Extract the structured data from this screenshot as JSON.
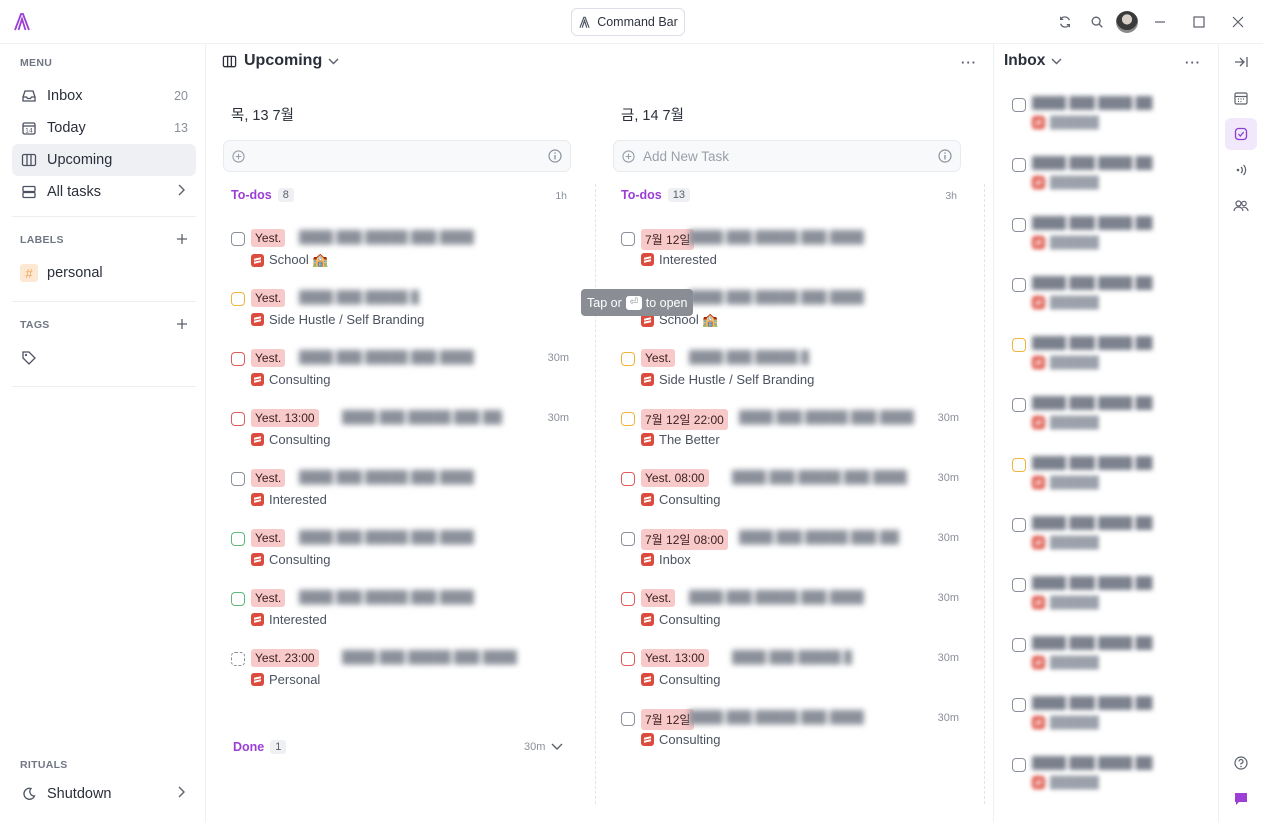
{
  "titlebar": {
    "command_bar_label": "Command Bar"
  },
  "sidebar": {
    "menu_title": "MENU",
    "items": [
      {
        "label": "Inbox",
        "count": "20",
        "icon": "inbox-icon"
      },
      {
        "label": "Today",
        "count": "13",
        "icon": "calendar-day-icon"
      },
      {
        "label": "Upcoming",
        "count": "",
        "icon": "columns-icon"
      },
      {
        "label": "All tasks",
        "count": "",
        "icon": "stack-icon"
      }
    ],
    "labels_title": "LABELS",
    "labels": [
      {
        "name": "personal",
        "color": "#f0a35a"
      }
    ],
    "tags_title": "TAGS",
    "rituals_title": "RITUALS",
    "rituals": [
      {
        "label": "Shutdown"
      }
    ]
  },
  "main": {
    "view_title": "Upcoming",
    "columns": [
      {
        "date": "목, 13 7월",
        "add_placeholder": "",
        "section_label": "To-dos",
        "section_count": "8",
        "section_time": "1h",
        "tasks": [
          {
            "badge": "Yest.",
            "project": "School 🏫",
            "duration": "",
            "check": "gray"
          },
          {
            "badge": "Yest.",
            "project": "Side Hustle / Self Branding",
            "duration": "",
            "check": "orange"
          },
          {
            "badge": "Yest.",
            "project": "Consulting",
            "duration": "30m",
            "check": "red"
          },
          {
            "badge": "Yest. 13:00",
            "project": "Consulting",
            "duration": "30m",
            "check": "red"
          },
          {
            "badge": "Yest.",
            "project": "Interested",
            "duration": "",
            "check": "gray"
          },
          {
            "badge": "Yest.",
            "project": "Consulting",
            "duration": "",
            "check": "green"
          },
          {
            "badge": "Yest.",
            "project": "Interested",
            "duration": "",
            "check": "green"
          },
          {
            "badge": "Yest. 23:00",
            "project": "Personal",
            "duration": "",
            "check": "dashed"
          }
        ],
        "done_label": "Done",
        "done_count": "1",
        "done_time": "30m"
      },
      {
        "date": "금, 14 7월",
        "add_placeholder": "Add New Task",
        "section_label": "To-dos",
        "section_count": "13",
        "section_time": "3h",
        "tasks": [
          {
            "badge": "7월 12일",
            "project": "Interested",
            "duration": "",
            "check": "gray"
          },
          {
            "badge": "Yest.",
            "project": "School 🏫",
            "duration": "",
            "check": "gray"
          },
          {
            "badge": "Yest.",
            "project": "Side Hustle / Self Branding",
            "duration": "",
            "check": "orange"
          },
          {
            "badge": "7월 12일 22:00",
            "project": "The Better",
            "duration": "30m",
            "check": "orange"
          },
          {
            "badge": "Yest. 08:00",
            "project": "Consulting",
            "duration": "30m",
            "check": "red"
          },
          {
            "badge": "7월 12일 08:00",
            "project": "Inbox",
            "duration": "30m",
            "check": "gray"
          },
          {
            "badge": "Yest.",
            "project": "Consulting",
            "duration": "30m",
            "check": "red"
          },
          {
            "badge": "Yest. 13:00",
            "project": "Consulting",
            "duration": "30m",
            "check": "red"
          },
          {
            "badge": "7월 12일",
            "project": "Consulting",
            "duration": "30m",
            "check": "gray"
          }
        ]
      }
    ],
    "tooltip": {
      "pre": "Tap or",
      "post": "to open"
    }
  },
  "inbox_panel": {
    "title": "Inbox",
    "items": [
      {
        "check": "gray"
      },
      {
        "check": "gray"
      },
      {
        "check": "gray"
      },
      {
        "check": "gray"
      },
      {
        "check": "orange"
      },
      {
        "check": "gray"
      },
      {
        "check": "orange"
      },
      {
        "check": "gray"
      },
      {
        "check": "gray"
      },
      {
        "check": "gray"
      },
      {
        "check": "gray"
      },
      {
        "check": "gray"
      }
    ]
  },
  "colors": {
    "accent": "#9b3fd6",
    "badge_bg": "#f8c9c9",
    "todoist_red": "#dc4c3e"
  }
}
